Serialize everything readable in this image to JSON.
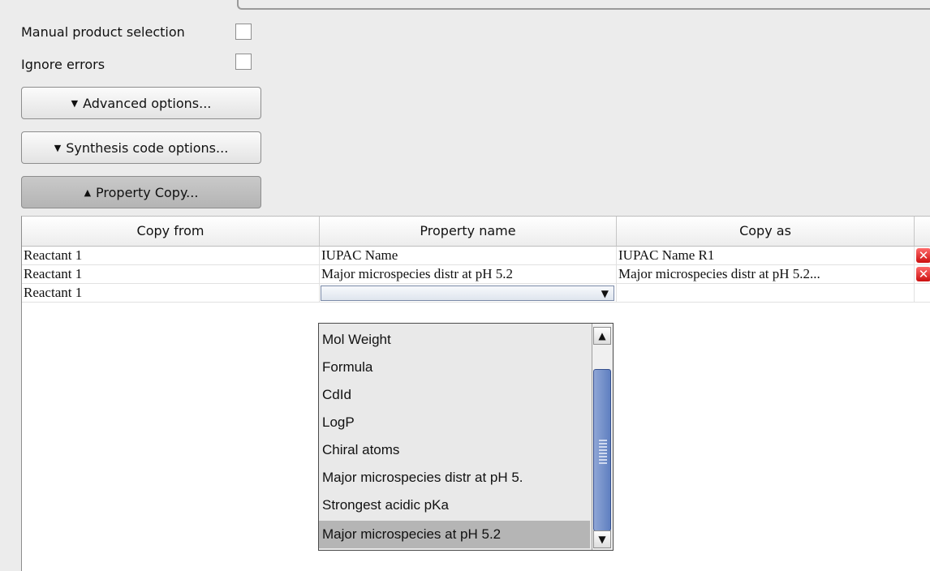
{
  "options": {
    "manual_product_selection": "Manual product selection",
    "ignore_errors": "Ignore errors"
  },
  "buttons": {
    "advanced": "Advanced options...",
    "synthesis": "Synthesis code options...",
    "property_copy": "Property Copy..."
  },
  "table": {
    "headers": [
      "Copy from",
      "Property name",
      "Copy as"
    ],
    "rows": [
      {
        "copy_from": "Reactant 1",
        "property": "IUPAC Name",
        "copy_as": "IUPAC Name R1"
      },
      {
        "copy_from": "Reactant 1",
        "property": "Major microspecies distr at pH 5.2",
        "copy_as": "Major microspecies distr at pH 5.2..."
      },
      {
        "copy_from": "Reactant 1",
        "property": "",
        "copy_as": ""
      }
    ]
  },
  "dropdown": {
    "items": [
      "Mol Weight",
      "Formula",
      "CdId",
      "LogP",
      "Chiral atoms",
      "Major microspecies distr at pH 5.",
      "Strongest acidic pKa",
      "Major microspecies at pH 5.2"
    ],
    "selected": "Major microspecies at pH 5.2"
  }
}
